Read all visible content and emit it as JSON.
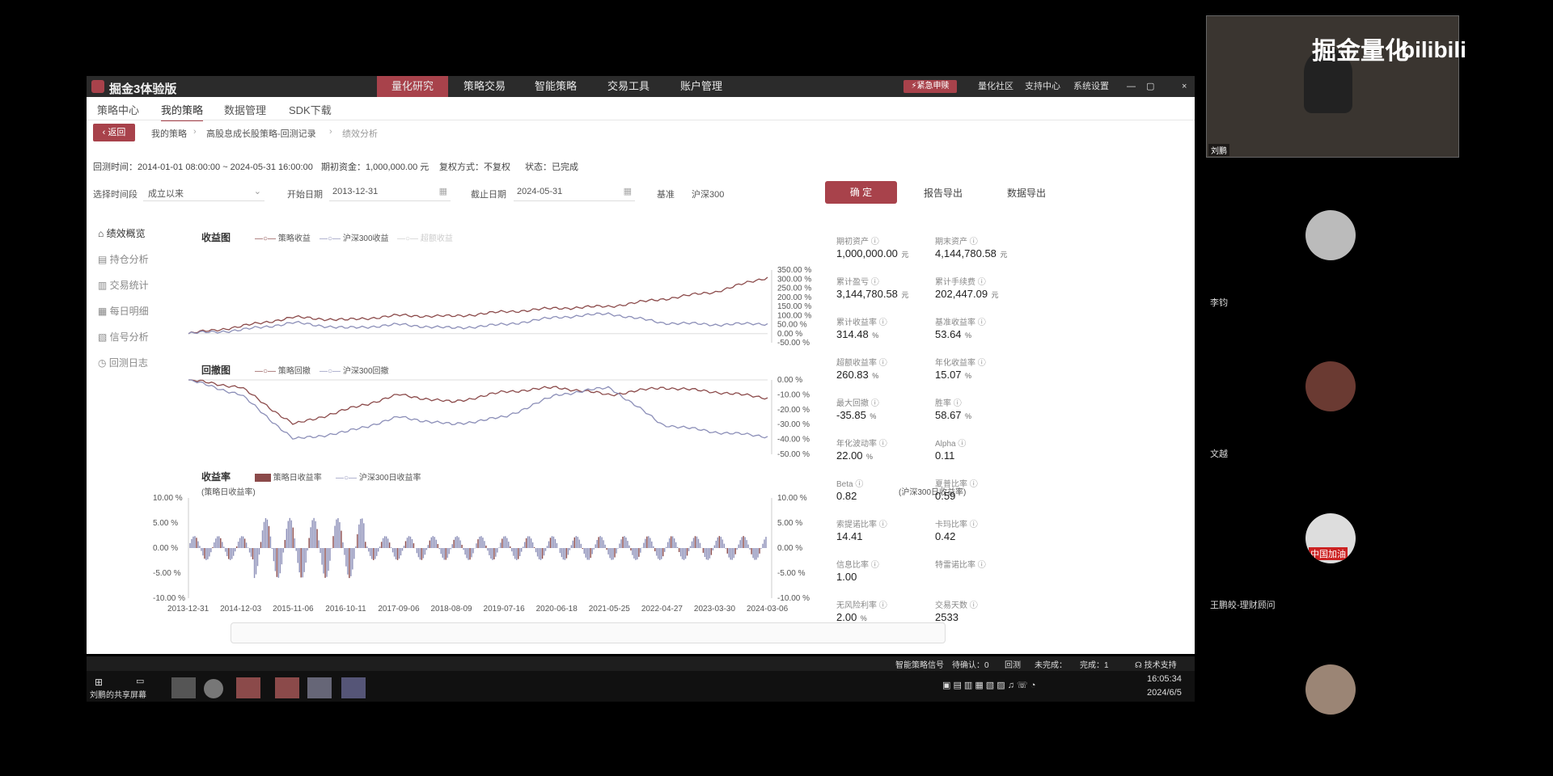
{
  "app": {
    "title": "掘金3体验版",
    "nav": [
      "量化研究",
      "策略交易",
      "智能策略",
      "交易工具",
      "账户管理"
    ],
    "active_nav": "量化研究",
    "right_btn": "紧急申赎",
    "right_links": [
      "量化社区",
      "支持中心",
      "系统设置"
    ]
  },
  "subnav": [
    "策略中心",
    "我的策略",
    "数据管理",
    "SDK下载"
  ],
  "breadcrumb": {
    "back": "返回",
    "items": [
      "我的策略",
      "高股息成长股策略-回测记录",
      "绩效分析"
    ]
  },
  "backtest_info": {
    "period": "回测时间：2014-01-01 08:00:00 ~ 2024-05-31 16:00:00",
    "capital": "期初资金：1,000,000.00 元",
    "rights": "复权方式：不复权",
    "status": "状态：已完成"
  },
  "controls": {
    "range_label": "选择时间段",
    "range_value": "成立以来",
    "start_label": "开始日期",
    "start_value": "2013-12-31",
    "end_label": "截止日期",
    "end_value": "2024-05-31",
    "bench_label": "基准",
    "bench_value": "沪深300",
    "confirm": "确 定",
    "report_export": "报告导出",
    "data_export": "数据导出"
  },
  "sidebar": [
    "绩效概览",
    "持仓分析",
    "交易统计",
    "每日明细",
    "信号分析",
    "回测日志"
  ],
  "charts": {
    "returns_title": "收益图",
    "returns_legend": [
      "策略收益",
      "沪深300收益",
      "超额收益"
    ],
    "drawdown_title": "回撤图",
    "drawdown_legend": [
      "策略回撤",
      "沪深300回撤"
    ],
    "daily_title": "收益率",
    "daily_legend": [
      "策略日收益率",
      "沪深300日收益率"
    ],
    "daily_left_label": "(策略日收益率)",
    "daily_right_label": "(沪深300日收益率)"
  },
  "chart_data": [
    {
      "type": "line",
      "title": "收益图",
      "x": [
        "2013-12-31",
        "2014-12-03",
        "2015-11-06",
        "2016-10-11",
        "2017-09-06",
        "2018-08-09",
        "2019-07-16",
        "2020-06-18",
        "2021-05-25",
        "2022-04-27",
        "2023-03-30",
        "2024-03-06"
      ],
      "series": [
        {
          "name": "策略收益",
          "values": [
            0,
            40,
            90,
            75,
            100,
            95,
            120,
            140,
            150,
            190,
            230,
            310
          ],
          "color": "#8b4a4a"
        },
        {
          "name": "沪深300收益",
          "values": [
            0,
            20,
            60,
            30,
            50,
            30,
            50,
            90,
            110,
            60,
            50,
            55
          ],
          "color": "#8c8fb8"
        }
      ],
      "yticks": [
        "350.00 %",
        "300.00 %",
        "250.00 %",
        "200.00 %",
        "150.00 %",
        "100.00 %",
        "50.00 %",
        "0.00 %",
        "-50.00 %"
      ],
      "ylim": [
        -50,
        350
      ]
    },
    {
      "type": "line",
      "title": "回撤图",
      "series": [
        {
          "name": "策略回撤",
          "values": [
            0,
            -5,
            -30,
            -20,
            -10,
            -15,
            -8,
            -5,
            -10,
            -5,
            -8,
            -12
          ],
          "color": "#8b4a4a"
        },
        {
          "name": "沪深300回撤",
          "values": [
            0,
            -10,
            -40,
            -35,
            -25,
            -30,
            -25,
            -10,
            -5,
            -30,
            -35,
            -38
          ],
          "color": "#8c8fb8"
        }
      ],
      "yticks": [
        "0.00 %",
        "-10.00 %",
        "-20.00 %",
        "-30.00 %",
        "-40.00 %",
        "-50.00 %"
      ],
      "ylim": [
        -50,
        0
      ]
    },
    {
      "type": "bar",
      "title": "收益率",
      "yticks": [
        "10.00 %",
        "5.00 %",
        "0.00 %",
        "-5.00 %",
        "-10.00 %"
      ],
      "ylim": [
        -10,
        10
      ]
    }
  ],
  "metrics": [
    {
      "label": "期初资产",
      "value": "1,000,000.00",
      "unit": "元"
    },
    {
      "label": "期末资产",
      "value": "4,144,780.58",
      "unit": "元"
    },
    {
      "label": "累计盈亏",
      "value": "3,144,780.58",
      "unit": "元"
    },
    {
      "label": "累计手续费",
      "value": "202,447.09",
      "unit": "元"
    },
    {
      "label": "累计收益率",
      "value": "314.48",
      "unit": "%"
    },
    {
      "label": "基准收益率",
      "value": "53.64",
      "unit": "%"
    },
    {
      "label": "超额收益率",
      "value": "260.83",
      "unit": "%"
    },
    {
      "label": "年化收益率",
      "value": "15.07",
      "unit": "%"
    },
    {
      "label": "最大回撤",
      "value": "-35.85",
      "unit": "%"
    },
    {
      "label": "胜率",
      "value": "58.67",
      "unit": "%"
    },
    {
      "label": "年化波动率",
      "value": "22.00",
      "unit": "%"
    },
    {
      "label": "Alpha",
      "value": "0.11",
      "unit": ""
    },
    {
      "label": "Beta",
      "value": "0.82",
      "unit": ""
    },
    {
      "label": "夏普比率",
      "value": "0.59",
      "unit": ""
    },
    {
      "label": "索提诺比率",
      "value": "14.41",
      "unit": ""
    },
    {
      "label": "卡玛比率",
      "value": "0.42",
      "unit": ""
    },
    {
      "label": "信息比率",
      "value": "1.00",
      "unit": ""
    },
    {
      "label": "特雷诺比率",
      "value": "",
      "unit": ""
    },
    {
      "label": "无风险利率",
      "value": "2.00",
      "unit": "%"
    },
    {
      "label": "交易天数",
      "value": "2533",
      "unit": ""
    }
  ],
  "statusbar": {
    "signal": "智能策略信号",
    "pending": "待确认：0",
    "review": "回测",
    "incomplete": "未完成：",
    "complete": "完成：1",
    "support": "技术支持"
  },
  "meeting": {
    "cam_overlay": "掘金量化",
    "bili": "bilibili",
    "cam_name": "刘鹏",
    "participants": [
      "李钧",
      "文越",
      "王鹏皎-理财顾问"
    ],
    "badge_text": "中国加油",
    "screen_share": "刘鹏的共享屏幕"
  },
  "clock": {
    "time": "16:05:34",
    "date": "2024/6/5"
  },
  "colors": {
    "accent": "#a8424b",
    "strategy": "#8b4a4a",
    "bench": "#8c8fb8"
  }
}
